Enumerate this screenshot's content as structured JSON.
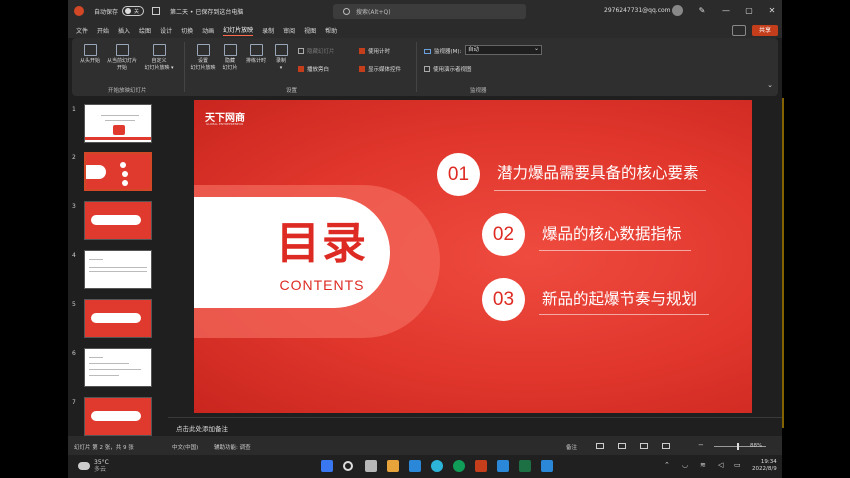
{
  "titlebar": {
    "autosave_label": "自动保存",
    "autosave_state": "关",
    "doc_title": "第二天 • 已保存到这台电脑",
    "search_placeholder": "搜索(Alt+Q)",
    "account": "2976247731@qq.com",
    "buttons": {
      "pen": "✎",
      "minimize": "—",
      "restore": "▢",
      "close": "✕"
    }
  },
  "menu": {
    "tabs": [
      "文件",
      "开始",
      "插入",
      "绘图",
      "设计",
      "切换",
      "动画",
      "幻灯片放映",
      "录制",
      "审阅",
      "视图",
      "帮助"
    ],
    "active_index": 7,
    "share_label": "共享"
  },
  "ribbon": {
    "start_group": {
      "from_start": [
        "从头开始"
      ],
      "from_current": [
        "从当前幻灯片",
        "开始"
      ],
      "custom": [
        "自定义",
        "幻灯片放映 ▾"
      ],
      "label": "开始放映幻灯片"
    },
    "setup_group": {
      "setup": [
        "设置",
        "幻灯片放映"
      ],
      "hide": [
        "隐藏",
        "幻灯片"
      ],
      "rehearse": [
        "排练计时"
      ],
      "record": [
        "录制",
        "▾"
      ],
      "checks": {
        "play_narration": "播放旁白",
        "use_timings": "使用计时",
        "show_media_controls": "显示媒体控件",
        "hide_slide_dim": "隐藏幻灯片"
      },
      "label": "设置"
    },
    "monitor_group": {
      "monitor_label": "监视器(M):",
      "monitor_value": "自动",
      "presenter_view": "使用演示者视图",
      "label": "监视器"
    },
    "collapse": "⌄"
  },
  "thumbnails": [
    "1",
    "2",
    "3",
    "4",
    "5",
    "6",
    "7"
  ],
  "selected_slide": 2,
  "slide": {
    "logo": "天下网商",
    "logo_sub": "GLOBAL ENTREPRENEUR",
    "title_cn": "目录",
    "title_en": "CONTENTS",
    "items": [
      {
        "num": "01",
        "text": "潜力爆品需要具备的核心要素"
      },
      {
        "num": "02",
        "text": "爆品的核心数据指标"
      },
      {
        "num": "03",
        "text": "新品的起爆节奏与规划"
      }
    ],
    "colors": {
      "bg": "#e0362c",
      "accent": "#dd2a22",
      "white": "#ffffff"
    }
  },
  "notes_placeholder": "点击此处添加备注",
  "status": {
    "slide_of": "幻灯片 第 2 张，共 9 张",
    "language": "中文(中国)",
    "accessibility": "辅助功能: 调查",
    "notes": "备注",
    "zoom": "88%"
  },
  "taskbar": {
    "temp": "35°C",
    "weather": "多云",
    "time": "19:34",
    "date": "2022/8/9",
    "app_icon_colors": [
      "#3a78f2",
      "#dddddd",
      "#e8a33a",
      "#2b88d8",
      "#2cb5d9",
      "#0f9d58",
      "#c43e1c",
      "#2b88d8",
      "#1d7044",
      "#2b88d8"
    ]
  }
}
